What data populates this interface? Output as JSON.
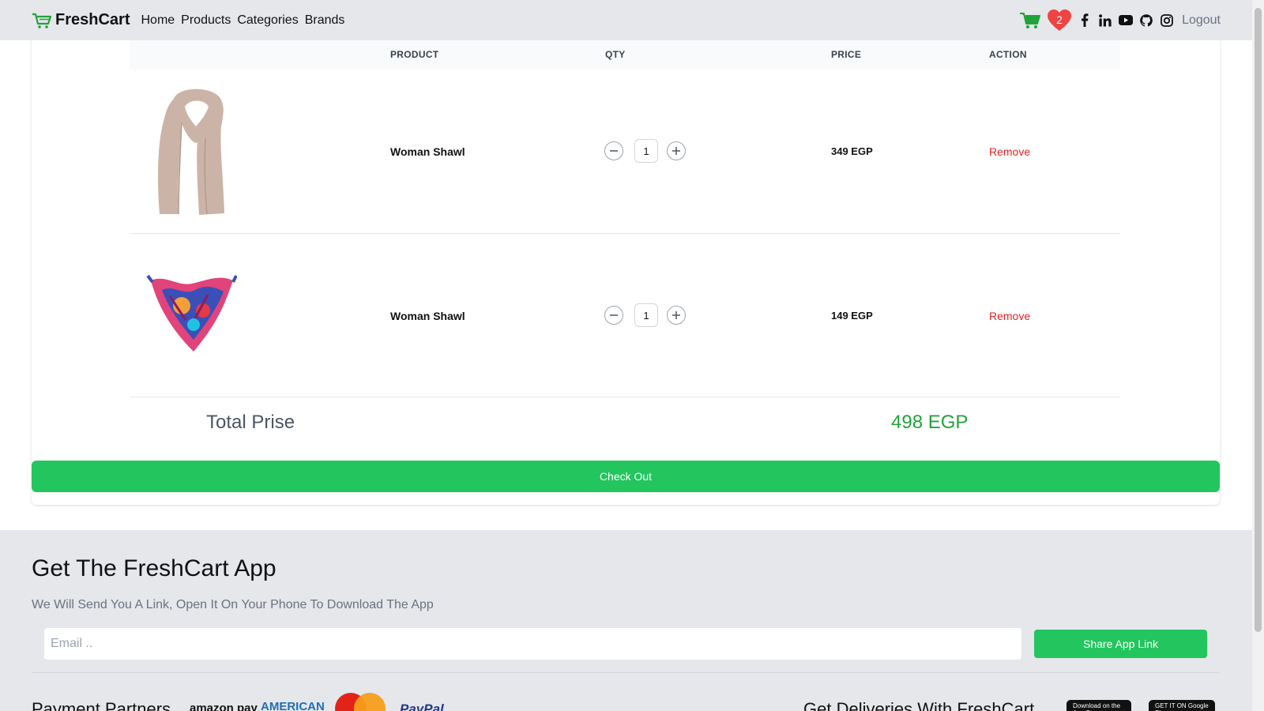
{
  "navbar": {
    "brand": "FreshCart",
    "links": [
      "Home",
      "Products",
      "Categories",
      "Brands"
    ],
    "wishlist_count": "2",
    "logout": "Logout"
  },
  "cart": {
    "headers": {
      "product": "PRODUCT",
      "qty": "QTY",
      "price": "PRICE",
      "action": "ACTION"
    },
    "items": [
      {
        "name": "Woman Shawl",
        "qty": "1",
        "price": "349 EGP",
        "action": "Remove",
        "image": "beige-scarf"
      },
      {
        "name": "Woman Shawl",
        "qty": "1",
        "price": "149 EGP",
        "action": "Remove",
        "image": "colorful-bandana"
      }
    ],
    "total_label": "Total Prise",
    "total_value": "498 EGP",
    "checkout": "Check Out"
  },
  "footer": {
    "title": "Get The FreshCart App",
    "subtitle": "We Will Send You A Link, Open It On Your Phone To Download The App",
    "email_placeholder": "Email ..",
    "share_button": "Share App Link",
    "payment_label": "Payment Partners",
    "payment_logos": {
      "amazon": "amazon pay",
      "amex": "AMERICAN",
      "mastercard": "MasterCard",
      "paypal": "PayPal"
    },
    "deliveries_label": "Get Deliveries With FreshCart",
    "store_badges": [
      "Download on the App Store",
      "GET IT ON Google Play"
    ]
  },
  "colors": {
    "accent": "#22c55e",
    "remove": "#dc2626",
    "heart": "#ef4444",
    "nav_bg": "#e5e7eb"
  }
}
